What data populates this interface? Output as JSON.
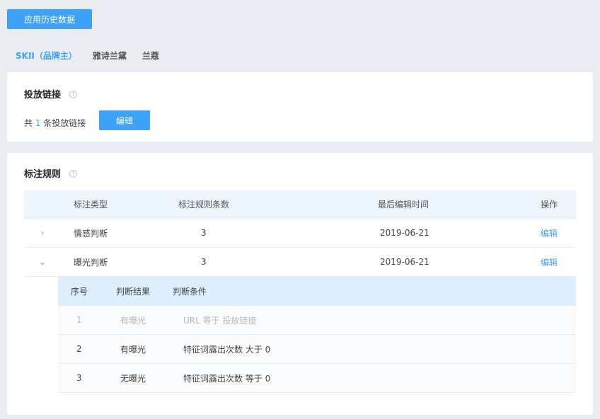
{
  "toolbar": {
    "apply_history_label": "应用历史数据"
  },
  "brands": [
    {
      "label": "SKII（品牌主）",
      "active": true
    },
    {
      "label": "雅诗兰黛",
      "active": false
    },
    {
      "label": "兰蔻",
      "active": false
    }
  ],
  "links_card": {
    "title": "投放链接",
    "help": "?",
    "count_prefix": "共",
    "count": "1",
    "count_suffix": "条投放链接",
    "edit_label": "编辑"
  },
  "rules_card": {
    "title": "标注规则",
    "help": "?",
    "columns": [
      "标注类型",
      "标注规则条数",
      "最后编辑时间",
      "操作"
    ],
    "rows": [
      {
        "expander": "›",
        "type": "情感判断",
        "count": "3",
        "time": "2019-06-21",
        "action": "编辑",
        "expanded": false
      },
      {
        "expander": "⌄",
        "type": "曝光判断",
        "count": "3",
        "time": "2019-06-21",
        "action": "编辑",
        "expanded": true
      }
    ],
    "sub_columns": [
      "序号",
      "判断结果",
      "判断条件"
    ],
    "sub_rows": [
      {
        "index": "1",
        "result": "有曝光",
        "condition": "URL 等于 投放链接",
        "dim": true
      },
      {
        "index": "2",
        "result": "有曝光",
        "condition": "特征词露出次数 大于 0",
        "dim": false
      },
      {
        "index": "3",
        "result": "无曝光",
        "condition": "特征词露出次数 等于 0",
        "dim": false
      }
    ]
  }
}
